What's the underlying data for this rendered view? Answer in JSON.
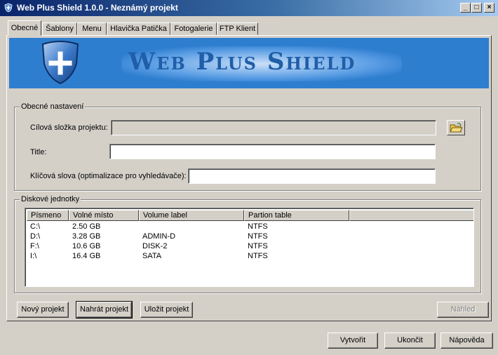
{
  "window": {
    "title": "Web Plus Shield 1.0.0 - Neznámý projekt",
    "controls": [
      "_",
      "□",
      "×"
    ]
  },
  "tabs": [
    {
      "label": "Obecné",
      "active": true
    },
    {
      "label": "Šablony",
      "active": false
    },
    {
      "label": "Menu",
      "active": false
    },
    {
      "label": "Hlavička  Patička",
      "active": false
    },
    {
      "label": "Fotogalerie",
      "active": false
    },
    {
      "label": "FTP Klient",
      "active": false
    }
  ],
  "banner": {
    "title": "Web Plus Shield",
    "logo_icon": "shield-plus-icon",
    "color": "#2e7ed0"
  },
  "general": {
    "legend": "Obecné nastavení",
    "project_folder_label": "Cílová složka projektu:",
    "project_folder_value": "",
    "title_label": "Title:",
    "title_value": "",
    "keywords_label": "Klíčová slova (optimalizace pro vyhledávače):",
    "keywords_value": "",
    "browse_icon": "open-folder-icon"
  },
  "drives": {
    "legend": "Diskové jednotky",
    "columns": [
      "Písmeno",
      "Volné místo",
      "Volume label",
      "Partion table",
      ""
    ],
    "rows": [
      [
        "C:\\",
        "2.50 GB",
        "",
        "NTFS"
      ],
      [
        "D:\\",
        "3.28 GB",
        "ADMIN-D",
        "NTFS"
      ],
      [
        "F:\\",
        "10.6 GB",
        "DISK-2",
        "NTFS"
      ],
      [
        "I:\\",
        "16.4 GB",
        "SATA",
        "NTFS"
      ]
    ]
  },
  "actions": {
    "new_project": "Nový projekt",
    "load_project": "Nahrát projekt",
    "save_project": "Uložit projekt",
    "preview": "Náhled"
  },
  "footer": {
    "create": "Vytvořit",
    "quit": "Ukončit",
    "help": "Nápověda"
  }
}
